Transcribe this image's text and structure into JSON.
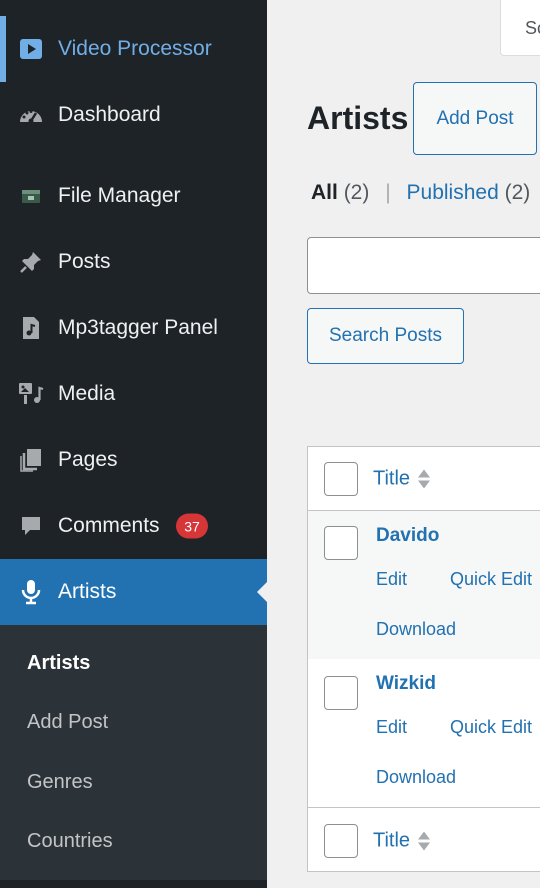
{
  "sidebar": {
    "top_item": {
      "label": "Video Processor",
      "icon": "video-icon"
    },
    "items": [
      {
        "label": "Dashboard",
        "icon": "dashboard-icon"
      },
      {
        "label": "File Manager",
        "icon": "folder-icon"
      },
      {
        "label": "Posts",
        "icon": "pin-icon"
      },
      {
        "label": "Mp3tagger Panel",
        "icon": "audio-file-icon"
      },
      {
        "label": "Media",
        "icon": "media-icon"
      },
      {
        "label": "Pages",
        "icon": "pages-icon"
      },
      {
        "label": "Comments",
        "icon": "comment-icon",
        "badge": "37"
      },
      {
        "label": "Artists",
        "icon": "microphone-icon"
      }
    ],
    "submenu": [
      "Artists",
      "Add Post",
      "Genres",
      "Countries"
    ]
  },
  "header": {
    "screen_options": "Sc",
    "title": "Artists",
    "add_post": "Add Post"
  },
  "filters": {
    "all_label": "All",
    "all_count": "(2)",
    "separator": "|",
    "published_label": "Published",
    "published_count": "(2)"
  },
  "search": {
    "value": "",
    "button": "Search Posts"
  },
  "table": {
    "column_title": "Title",
    "rows": [
      {
        "title": "Davido",
        "actions": [
          "Edit",
          "Quick Edit",
          "Download"
        ]
      },
      {
        "title": "Wizkid",
        "actions": [
          "Edit",
          "Quick Edit",
          "Download"
        ]
      }
    ]
  },
  "colors": {
    "sidebar_bg": "#1d2327",
    "active_bg": "#2271b1",
    "link": "#2271b1",
    "badge": "#d63638"
  }
}
